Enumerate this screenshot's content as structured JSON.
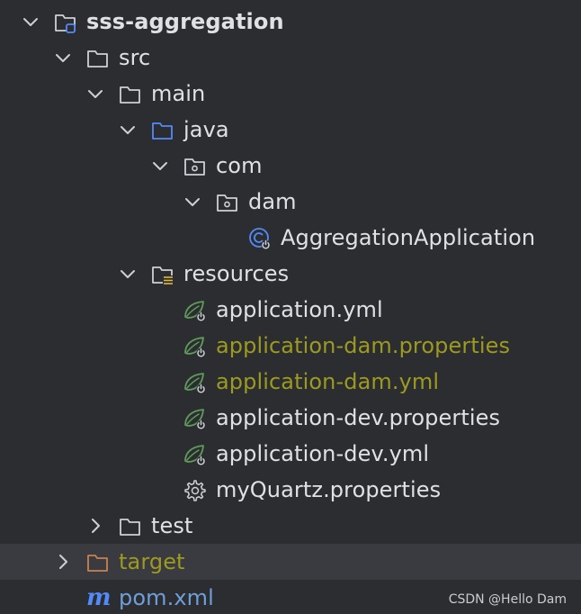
{
  "tree": {
    "root": {
      "label": "sss-aggregation"
    },
    "src": {
      "label": "src"
    },
    "main": {
      "label": "main"
    },
    "java": {
      "label": "java"
    },
    "com": {
      "label": "com"
    },
    "dam": {
      "label": "dam"
    },
    "app_class": {
      "label": "AggregationApplication"
    },
    "resources": {
      "label": "resources"
    },
    "files": [
      {
        "label": "application.yml",
        "status": "normal"
      },
      {
        "label": "application-dam.properties",
        "status": "modified"
      },
      {
        "label": "application-dam.yml",
        "status": "modified"
      },
      {
        "label": "application-dev.properties",
        "status": "normal"
      },
      {
        "label": "application-dev.yml",
        "status": "normal"
      },
      {
        "label": "myQuartz.properties",
        "status": "normal"
      }
    ],
    "test": {
      "label": "test"
    },
    "target": {
      "label": "target"
    },
    "pom": {
      "label": "pom.xml",
      "icon_glyph": "m"
    }
  },
  "watermark": "CSDN @Hello Dam",
  "colors": {
    "background": "#2b2d30",
    "text": "#dfe1e5",
    "modified": "#9c9a20",
    "excluded": "#c78250",
    "folder_blue": "#548af7",
    "spring_green": "#5f9b5a"
  },
  "icons": {
    "chevron_down": "chevron-down-icon",
    "chevron_right": "chevron-right-icon",
    "folder": "folder-icon",
    "module_folder": "module-folder-icon",
    "source_folder": "source-folder-icon",
    "package": "package-icon",
    "spring_class": "spring-boot-class-icon",
    "resources_folder": "resources-folder-icon",
    "spring_config": "spring-config-icon",
    "settings_file": "gear-icon",
    "excluded_folder": "excluded-folder-icon",
    "maven": "maven-icon"
  }
}
